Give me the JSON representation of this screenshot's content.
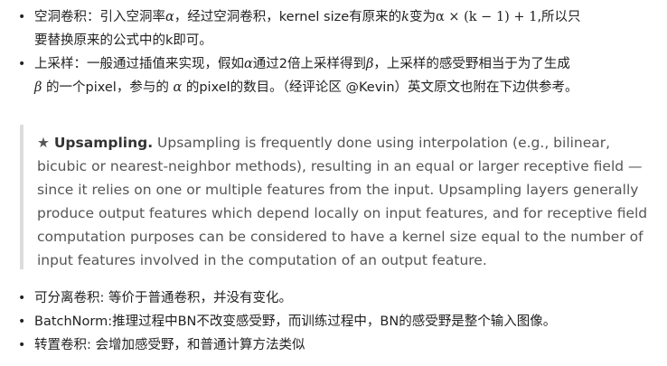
{
  "top_items": [
    {
      "l1_a": "空洞卷积：引入空洞率",
      "alpha": "α",
      "l1_b": "，经过空洞卷积，kernel size有原来的",
      "k": "k",
      "l1_c": "变为",
      "formula": "α × (k − 1) + 1",
      "l1_d": ",所以只",
      "l2": "要替换原来的公式中的k即可。"
    },
    {
      "l1_a": "上采样：一般通过插值来实现，假如",
      "alpha": "α",
      "l1_b": "通过2倍上采样得到",
      "beta": "β",
      "l1_c": "，上采样的感受野相当于为了生成",
      "beta2": "β",
      "l2_a": " 的一个pixel，参与的 ",
      "alpha2": "α",
      "l2_b": " 的pixel的数目。（经评论区 @Kevin）英文原文也附在下边供参考。"
    }
  ],
  "quote": {
    "star": "★",
    "title": "Upsampling.",
    "lines": [
      " Upsampling is frequently done using interpolation (e.g., bilinear,",
      "bicubic or nearest-neighbor methods), resulting in an equal or larger receptive field —",
      "since it relies on one or multiple features from the input. Upsampling layers generally",
      "produce output features which depend locally on input features, and for receptive field",
      "computation purposes can be considered to have a kernel size equal to the number of",
      "input features involved in the computation of an output feature."
    ]
  },
  "bottom_items": [
    "可分离卷积: 等价于普通卷积，并没有变化。",
    "BatchNorm:推理过程中BN不改变感受野，而训练过程中，BN的感受野是整个输入图像。",
    "转置卷积: 会增加感受野，和普通计算方法类似"
  ],
  "bullet": "•"
}
